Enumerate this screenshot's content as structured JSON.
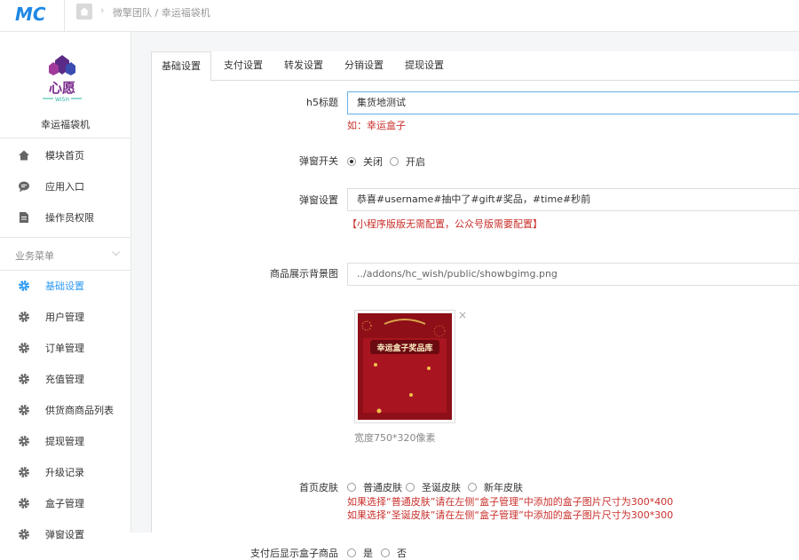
{
  "topbar": {
    "logo_text": "MC",
    "breadcrumb": "微擎团队 / 幸运福袋机"
  },
  "sidebar": {
    "brand_logo_text": "心愿",
    "brand_logo_sub": "WISH",
    "brand_name": "幸运福袋机",
    "top_items": [
      {
        "label": "模块首页",
        "icon": "home-icon"
      },
      {
        "label": "应用入口",
        "icon": "chat-icon"
      },
      {
        "label": "操作员权限",
        "icon": "document-icon"
      }
    ],
    "section_label": "业务菜单",
    "items": [
      {
        "label": "基础设置",
        "icon": "gear-icon",
        "active": true
      },
      {
        "label": "用户管理",
        "icon": "gear-icon"
      },
      {
        "label": "订单管理",
        "icon": "gear-icon"
      },
      {
        "label": "充值管理",
        "icon": "gear-icon"
      },
      {
        "label": "供货商商品列表",
        "icon": "gear-icon"
      },
      {
        "label": "提现管理",
        "icon": "gear-icon"
      },
      {
        "label": "升级记录",
        "icon": "gear-icon"
      },
      {
        "label": "盒子管理",
        "icon": "gear-icon"
      },
      {
        "label": "弹窗设置",
        "icon": "gear-icon"
      }
    ]
  },
  "tabs": [
    "基础设置",
    "支付设置",
    "转发设置",
    "分销设置",
    "提现设置"
  ],
  "form": {
    "h5_title": {
      "label": "h5标题",
      "value": "集货地测试",
      "hint": "如：幸运盒子"
    },
    "popup_switch": {
      "label": "弹窗开关",
      "options": [
        "关闭",
        "开启"
      ],
      "selected": "关闭"
    },
    "popup_setting": {
      "label": "弹窗设置",
      "value": "恭喜#username#抽中了#gift#奖品，#time#秒前",
      "hint": "【小程序版版无需配置，公众号版需要配置】"
    },
    "bg_image": {
      "label": "商品展示背景图",
      "value": "../addons/hc_wish/public/showbgimg.png",
      "image_text": "幸运盒子奖品库",
      "caption": "宽度750*320像素",
      "close": "×"
    },
    "skin": {
      "label": "首页皮肤",
      "options": [
        "普通皮肤",
        "圣诞皮肤",
        "新年皮肤"
      ],
      "hint1": "如果选择“普通皮肤”请在左侧“盒子管理”中添加的盒子图片尺寸为300*400",
      "hint2": "如果选择“圣诞皮肤”请在左侧“盒子管理”中添加的盒子图片尺寸为300*300"
    },
    "pay_show": {
      "label": "支付后显示盒子商品",
      "options": [
        "是",
        "否"
      ]
    }
  },
  "colors": {
    "accent": "#2f9bf4",
    "hint_red": "#c9302c",
    "logo_blue": "#1e88e5",
    "brand_purple": "#7b2d8e"
  }
}
